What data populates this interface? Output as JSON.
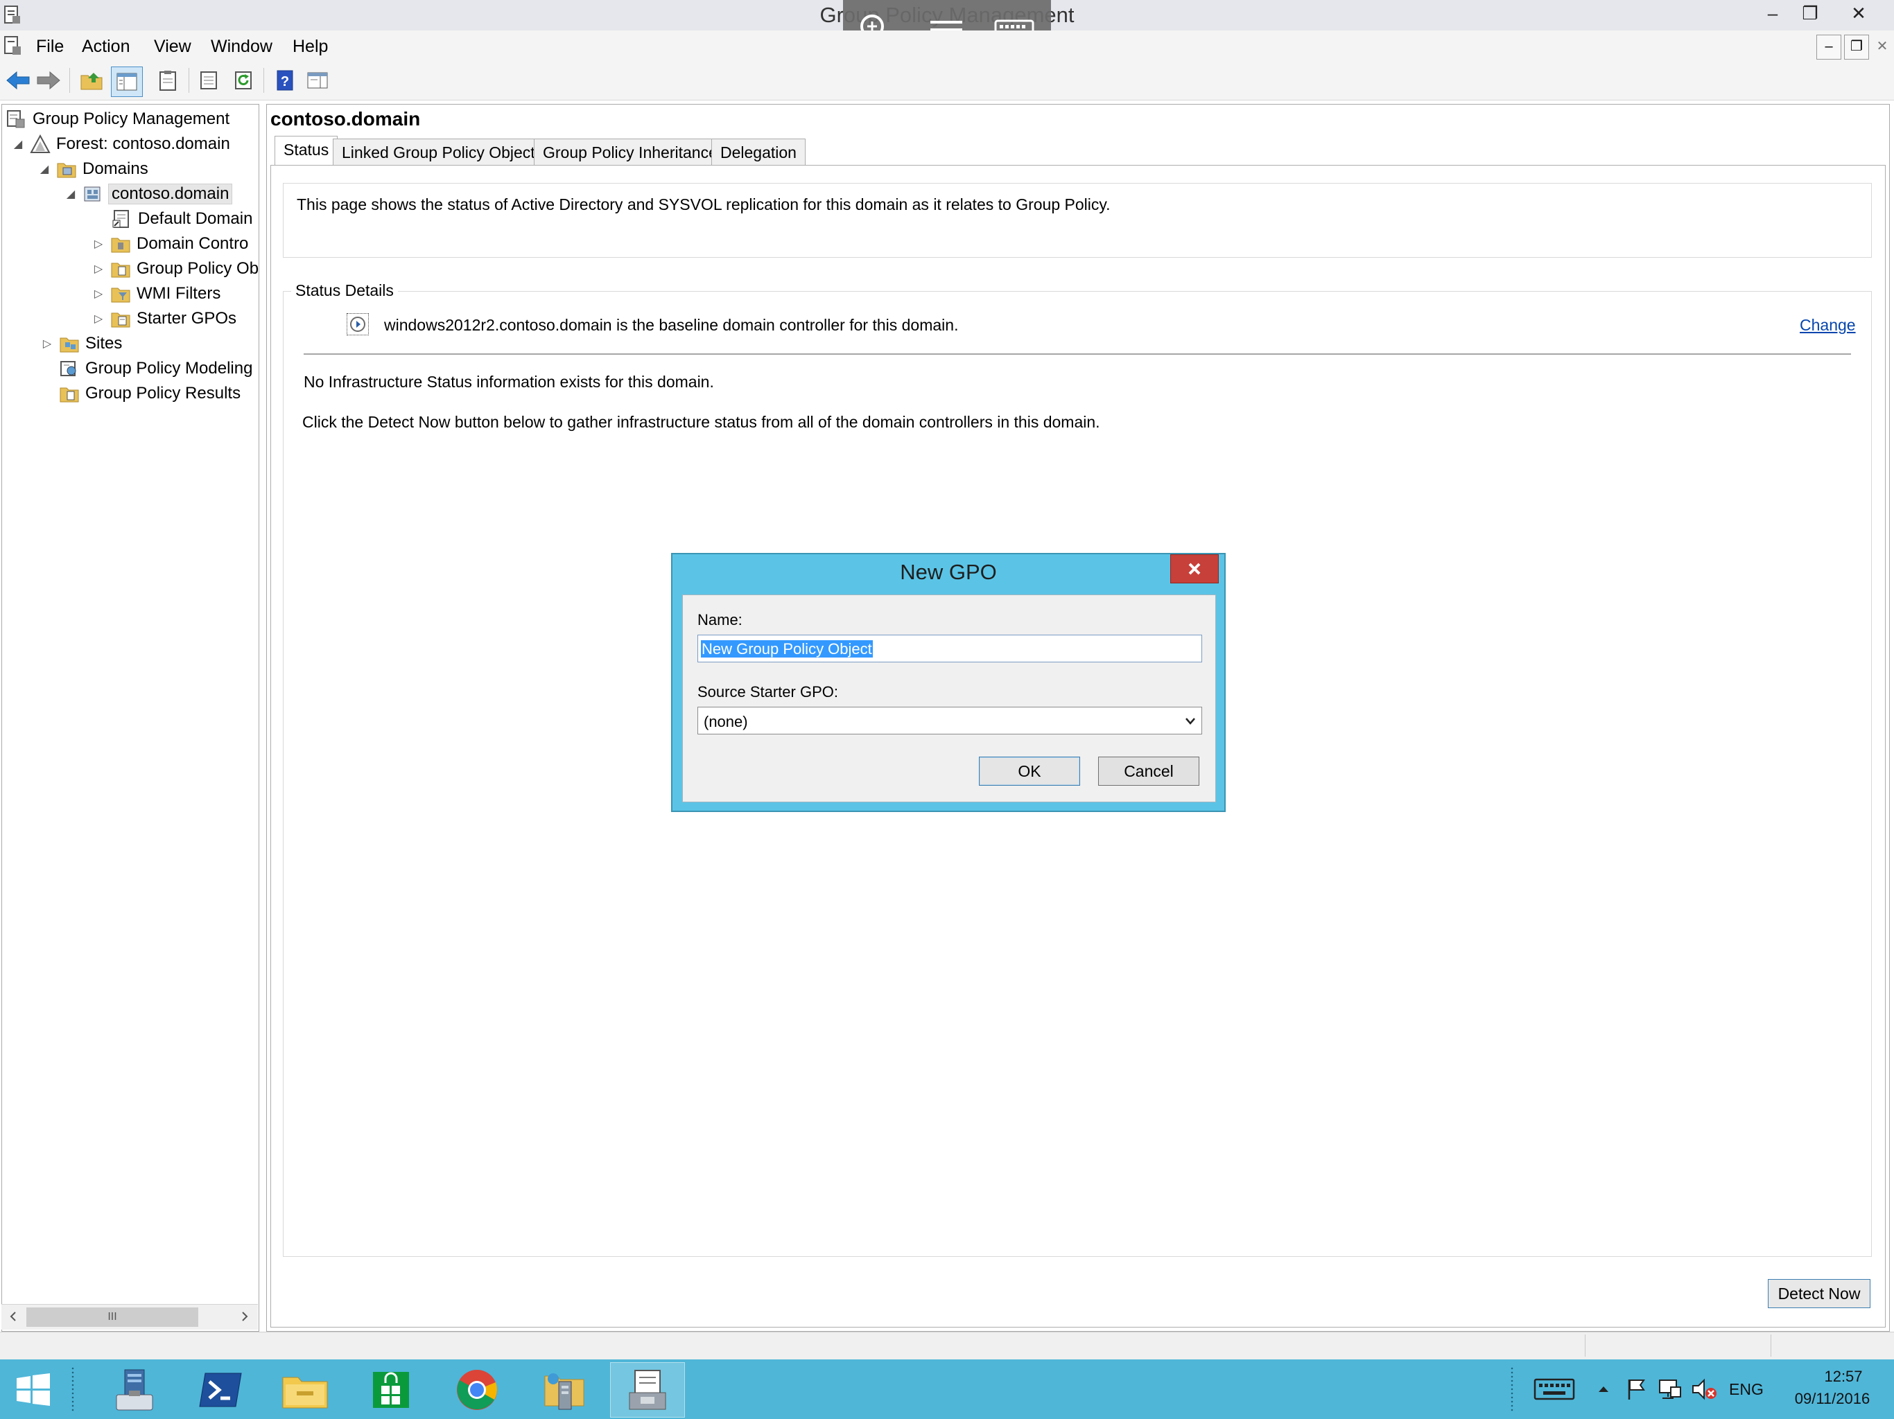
{
  "window": {
    "title": "Group Policy Management",
    "min_glyph": "–",
    "restore_glyph": "❐",
    "close_glyph": "✕"
  },
  "menubar": {
    "items": [
      "File",
      "Action",
      "View",
      "Window",
      "Help"
    ],
    "mdi_min": "–",
    "mdi_restore": "❐",
    "mdi_close": "✕"
  },
  "toolbar": {
    "icons": [
      "back-arrow-icon",
      "forward-arrow-icon",
      "up-folder-icon",
      "show-hide-tree-icon",
      "clipboard-icon",
      "properties-icon",
      "refresh-icon",
      "help-icon",
      "action-pane-icon"
    ]
  },
  "tree": {
    "root": "Group Policy Management",
    "forest": "Forest: contoso.domain",
    "domains": "Domains",
    "domain": "contoso.domain",
    "default_domain": "Default Domain",
    "domain_controllers": "Domain Contro",
    "gpo_objects": "Group Policy Ob",
    "wmi_filters": "WMI Filters",
    "starter_gpos": "Starter GPOs",
    "sites": "Sites",
    "modeling": "Group Policy Modeling",
    "results": "Group Policy Results",
    "expanded_glyph": "◢",
    "collapsed_glyph": "▷",
    "scroll_thumb": "III"
  },
  "details": {
    "title": "contoso.domain",
    "tabs": [
      "Status",
      "Linked Group Policy Objects",
      "Group Policy Inheritance",
      "Delegation"
    ],
    "intro": "This page shows the status of Active Directory and SYSVOL replication for this domain as it relates to Group Policy.",
    "status_details_label": "Status Details",
    "baseline": "windows2012r2.contoso.domain is the baseline domain controller for this domain.",
    "change_link": "Change",
    "no_info": "No Infrastructure Status information exists for this domain.",
    "detect_instructions": "Click the Detect Now button below to gather infrastructure status from all of the domain controllers in this domain.",
    "detect_button": "Detect Now"
  },
  "dialog": {
    "title": "New GPO",
    "name_label": "Name:",
    "name_value": "New Group Policy Object",
    "source_label": "Source Starter GPO:",
    "source_value": "(none)",
    "ok": "OK",
    "cancel": "Cancel"
  },
  "taskbar": {
    "apps": [
      "start-button",
      "server-manager-icon",
      "powershell-icon",
      "file-explorer-icon",
      "store-icon",
      "chrome-icon",
      "network-tool-icon",
      "group-policy-management-icon"
    ],
    "tray_icons": [
      "touch-keyboard-icon",
      "show-hidden-icons-chevron",
      "action-center-flag-icon",
      "network-icon",
      "volume-muted-icon"
    ],
    "language": "ENG",
    "time": "12:57",
    "date": "09/11/2016"
  },
  "colors": {
    "accent": "#5bc4e6",
    "taskbar": "#4fb6d8",
    "close_red": "#c7403a",
    "selection": "#3399ff",
    "link": "#0645ad"
  }
}
